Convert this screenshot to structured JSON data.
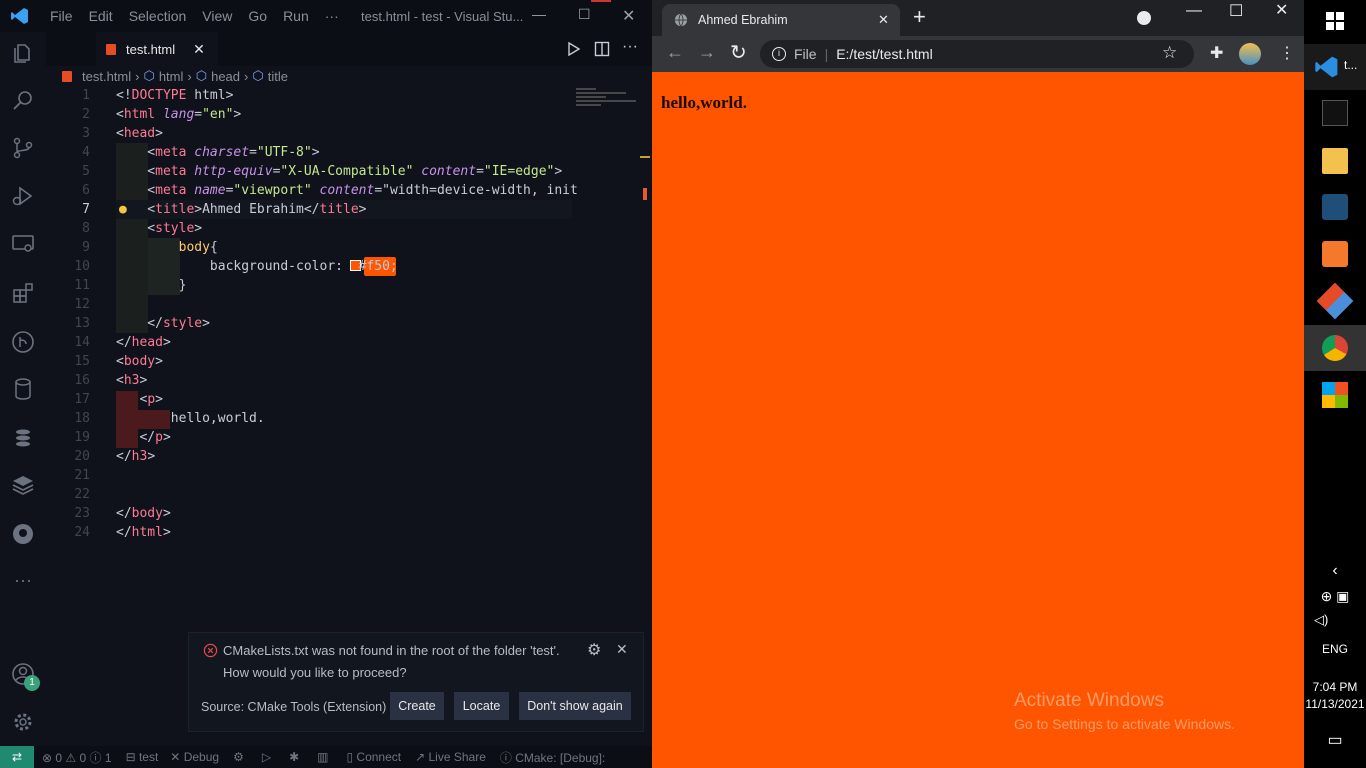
{
  "vscode": {
    "menu": [
      "File",
      "Edit",
      "Selection",
      "View",
      "Go",
      "Run",
      "···"
    ],
    "window_title": "test.html - test - Visual Stu...",
    "tab_label": "test.html",
    "breadcrumb": [
      "test.html",
      "html",
      "head",
      "title"
    ],
    "lines": [
      {
        "n": "1",
        "t": "<!DOCTYPE html>"
      },
      {
        "n": "2",
        "t": "<html lang=\"en\">"
      },
      {
        "n": "3",
        "t": "<head>"
      },
      {
        "n": "4",
        "t": "    <meta charset=\"UTF-8\">"
      },
      {
        "n": "5",
        "t": "    <meta http-equiv=\"X-UA-Compatible\" content=\"IE=edge\">"
      },
      {
        "n": "6",
        "t": "    <meta name=\"viewport\" content=\"width=device-width, init"
      },
      {
        "n": "7",
        "t": "    <title>Ahmed Ebrahim</title>"
      },
      {
        "n": "8",
        "t": "    <style>"
      },
      {
        "n": "9",
        "t": "        body{"
      },
      {
        "n": "10",
        "t": "            background-color:  #f50;"
      },
      {
        "n": "11",
        "t": "        }"
      },
      {
        "n": "12",
        "t": ""
      },
      {
        "n": "13",
        "t": "    </style>"
      },
      {
        "n": "14",
        "t": "</head>"
      },
      {
        "n": "15",
        "t": "<body>"
      },
      {
        "n": "16",
        "t": "<h3>"
      },
      {
        "n": "17",
        "t": "   <p>"
      },
      {
        "n": "18",
        "t": "       hello,world."
      },
      {
        "n": "19",
        "t": "   </p>"
      },
      {
        "n": "20",
        "t": "</h3>"
      },
      {
        "n": "21",
        "t": ""
      },
      {
        "n": "22",
        "t": ""
      },
      {
        "n": "23",
        "t": "</body>"
      },
      {
        "n": "24",
        "t": "</html>"
      }
    ],
    "notification": {
      "message": "CMakeLists.txt was not found in the root of the folder 'test'.",
      "question": "How would you like to proceed?",
      "source": "Source: CMake Tools (Extension)",
      "buttons": [
        "Create",
        "Locate",
        "Don't show again"
      ]
    },
    "status": {
      "errors": "0",
      "warnings": "0",
      "info": "1",
      "folder": "test",
      "debug": "Debug",
      "connect": "Connect",
      "liveshare": "Live Share",
      "cmake": "CMake: [Debug]:"
    },
    "accounts_badge": "1"
  },
  "chrome": {
    "tab_title": "Ahmed Ebrahim",
    "url_scheme": "File",
    "url": "E:/test/test.html",
    "page_text": "hello,world.",
    "page_bg": "#ff5500",
    "watermark_title": "Activate Windows",
    "watermark_sub": "Go to Settings to activate Windows."
  },
  "taskbar": {
    "vscode_label": "t...",
    "language": "ENG",
    "time": "7:04 PM",
    "date": "11/13/2021"
  }
}
